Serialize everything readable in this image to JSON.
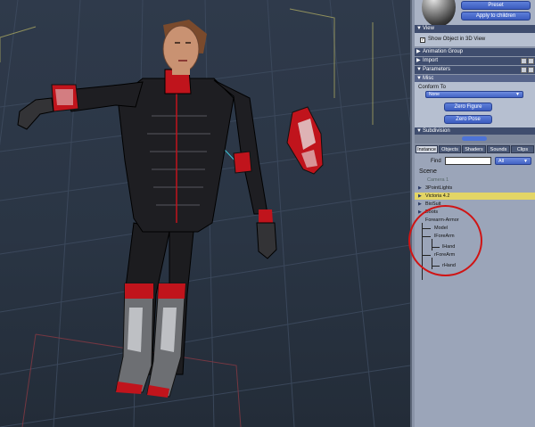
{
  "surface": {
    "preset_button": "Preset",
    "apply_button": "Apply to children"
  },
  "sections": {
    "view": "View",
    "show_object_label": "Show Object in 3D View",
    "show_object_checked": true,
    "animation_group": "Animation Group",
    "import": "Import",
    "parameters": "Parameters",
    "misc": "Misc",
    "subdivision": "Subdivision"
  },
  "misc": {
    "conform_to_label": "Conform To",
    "conform_to_value": "None",
    "zero_figure_button": "Zero Figure",
    "zero_pose_button": "Zero Pose"
  },
  "tabs": [
    "Instance",
    "Objects",
    "Shaders",
    "Sounds",
    "Clips"
  ],
  "active_tab": "Instance",
  "scene": {
    "find_label": "Find",
    "find_value": "",
    "filter_value": "All",
    "title": "Scene",
    "items": [
      {
        "label": "Camera 1",
        "level": 0,
        "expander": false,
        "style": "dim"
      },
      {
        "label": "3PointLights",
        "level": 0,
        "expander": true,
        "style": "normal"
      },
      {
        "label": "Victoria 4.2",
        "level": 0,
        "expander": true,
        "style": "selected"
      },
      {
        "label": "BioSuit",
        "level": 0,
        "expander": true,
        "style": "normal"
      },
      {
        "label": "Boots",
        "level": 0,
        "expander": true,
        "style": "normal"
      },
      {
        "label": "Forearm-Armor",
        "level": 0,
        "expander": false,
        "style": "normal"
      },
      {
        "label": "Model",
        "level": 1,
        "expander": false,
        "style": "normal"
      },
      {
        "label": "lForeArm",
        "level": 1,
        "expander": false,
        "style": "normal"
      },
      {
        "label": "lHand",
        "level": 2,
        "expander": false,
        "style": "normal"
      },
      {
        "label": "rForeArm",
        "level": 1,
        "expander": false,
        "style": "normal"
      },
      {
        "label": "rHand",
        "level": 2,
        "expander": false,
        "style": "normal"
      }
    ]
  },
  "colors": {
    "accent_button": "#4a6bd0",
    "selected_row": "#e3d565",
    "annotation_circle": "#d01414",
    "suit": "#1b1b1d",
    "armor_red": "#c0141c"
  }
}
